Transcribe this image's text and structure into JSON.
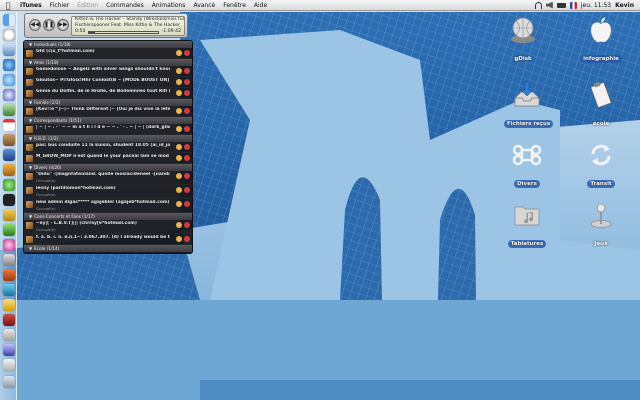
{
  "menubar": {
    "app_name": "iTunes",
    "menus": [
      "Fichier",
      "Édition",
      "Commandes",
      "Animations",
      "Avancé",
      "Fenêtre"
    ],
    "help": "Aide",
    "clock": "jeu. 11:53",
    "user": "Kevin"
  },
  "itunes": {
    "prev_symbol": "◀◀",
    "play_symbol": "❚❚",
    "next_symbol": "▶▶",
    "line1": "Kitten & The Hacker – Standy (Wreckelsmiss full of",
    "line2": "Fischerspooner Feat. Miss Kittin & The Hacker",
    "elapsed": "0:54",
    "remaining": "-1:09:42",
    "progress": 0.08
  },
  "contacts": {
    "groups": [
      {
        "label": "Individuals (1/18)",
        "rows": [
          {
            "name": "Gfd (c|o_t*hotmail.com)",
            "status": ""
          }
        ]
      },
      {
        "label": "Amis (1/18)",
        "rows": [
          {
            "name": "Gamedolose ~ Angelz with silver wings shouldn't know sollce...",
            "status": ""
          },
          {
            "name": "Gloutos~ Pi!Gfoix!Hhr Conlost(B ~ [MODE BOOST ON] ........",
            "status": ""
          },
          {
            "name": "Gnnie du Dolfin. de m Hrolle, de Bollemniles tout Rifl (pas lo)]",
            "status": ""
          }
        ]
      },
      {
        "label": "Famille (2/2)",
        "rows": [
          {
            "name": "[Kev!!e™]~|~ Think Different |~     [Oui je dis vive la lete] <...",
            "status": ""
          }
        ]
      },
      {
        "label": "Correspondants (1/51)",
        "rows": [
          {
            "name": "| ~ | ~ . · ' ~ ~ m a t h i l d e ~ ~ . ' · . ~ | ~ | (dark_glam...",
            "status": ""
          }
        ]
      },
      {
        "label": "R.B.D. (1/2)",
        "rows": [
          {
            "name": "pas: bus conduite 11 la kuisin, shudent 18.05 (ai_id_jolepal)...",
            "status": ""
          },
          {
            "name": "M_GROW_MOP n'est quand le your pacnal lam se mod sample...",
            "status": ""
          }
        ]
      },
      {
        "label": "Divers (4/26)",
        "rows": [
          {
            "name": "\"Didu\" -[magnfatenland. quelle moslacideneel -[nandiae...",
            "status": "Occupé(e)"
          },
          {
            "name": "lesny (parlillomon*hotmail.com)",
            "status": "Occupé(e)"
          },
          {
            "name": "new admin digas***** agajebler (agajeb*hotmail.com)",
            "status": "Occupé(e)"
          }
        ]
      },
      {
        "label": "Cons-Concerts et Fans (1/17)",
        "rows": [
          {
            "name": "~ey|[ - L.B.V.T]||| (chrrsy[6*hotmail.com)",
            "status": "Occupé(e)"
          },
          {
            "name": "f. a. b. i. n. e.n.1~: 3.067.307. (d) I already would be the life in...",
            "status": ""
          }
        ]
      },
      {
        "label": "École (1/14)",
        "rows": [
          {
            "name": "Gillier me helle! ... lor isomes out le langage mont de la deut...",
            "status": ""
          },
          {
            "name": "[:]4:19.115.900] | ~ | ~ '·.¸¸.·'··`·.¸~ *• · · · mdr er [o ▶",
            "status": ""
          }
        ]
      }
    ]
  },
  "desktop_icons": [
    {
      "id": "idisk",
      "label": "gDisk",
      "icon": "idisk-globe-icon"
    },
    {
      "id": "infographie",
      "label": "infographie",
      "icon": "apple-logo-icon"
    },
    {
      "id": "fichiers-recus",
      "label": "Fichiers reçus",
      "icon": "download-tray-icon"
    },
    {
      "id": "ecole",
      "label": "école",
      "icon": "clipboard-icon"
    },
    {
      "id": "divers",
      "label": "Divers",
      "icon": "command-key-icon"
    },
    {
      "id": "transit",
      "label": "Transit",
      "icon": "sync-arrows-icon"
    },
    {
      "id": "tablatures",
      "label": "Tablatures",
      "icon": "music-folder-icon"
    },
    {
      "id": "jeux",
      "label": "Jeux",
      "icon": "joystick-icon"
    }
  ]
}
